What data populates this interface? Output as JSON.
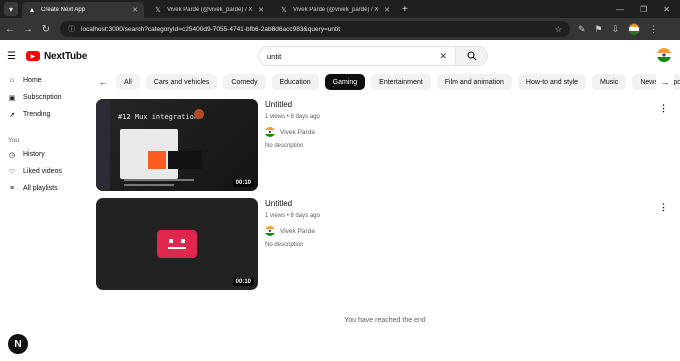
{
  "browser": {
    "tabs": [
      {
        "label": "Create Next App",
        "active": true,
        "icon": "next-favicon"
      },
      {
        "label": "Vivek Parde (@vivek_parde) / X",
        "active": false,
        "icon": "x-favicon"
      },
      {
        "label": "Vivek Parde (@vivek_parde) / X",
        "active": false,
        "icon": "x-favicon"
      }
    ],
    "url": "localhost:3000/search?categoryId=c25400d9-7055-4741-bfb6-2ab8d6acc983&query=untit"
  },
  "header": {
    "logo_text": "NextTube",
    "search_value": "untit"
  },
  "sidebar": {
    "items": [
      {
        "label": "Home",
        "icon": "home-icon"
      },
      {
        "label": "Subscription",
        "icon": "subscription-icon"
      },
      {
        "label": "Trending",
        "icon": "trending-icon"
      }
    ],
    "section_title": "You",
    "you_items": [
      {
        "label": "History",
        "icon": "history-icon"
      },
      {
        "label": "Liked videos",
        "icon": "thumbs-up-icon"
      },
      {
        "label": "All playlists",
        "icon": "playlist-icon"
      }
    ]
  },
  "chips": [
    "All",
    "Cars and vehicles",
    "Comedy",
    "Education",
    "Gaming",
    "Entertainment",
    "Film and animation",
    "How-to and style",
    "Music",
    "News and politics"
  ],
  "selected_chip": "Gaming",
  "results": [
    {
      "title": "Untitled",
      "views": "1 views",
      "age": "8 days ago",
      "channel": "Vivek Parde",
      "description": "No description",
      "duration": "00:10",
      "thumb_text": "#12 Mux integration"
    },
    {
      "title": "Untitled",
      "views": "1 views",
      "age": "8 days ago",
      "channel": "Vivek Parde",
      "description": "No description",
      "duration": "00:10"
    }
  ],
  "end_message": "You have reached the end",
  "colors": {
    "brand": "#ff0000",
    "chip_selected": "#0f0f0f",
    "chip_default": "#f2f2f2",
    "error_thumb": "#e0284e"
  }
}
